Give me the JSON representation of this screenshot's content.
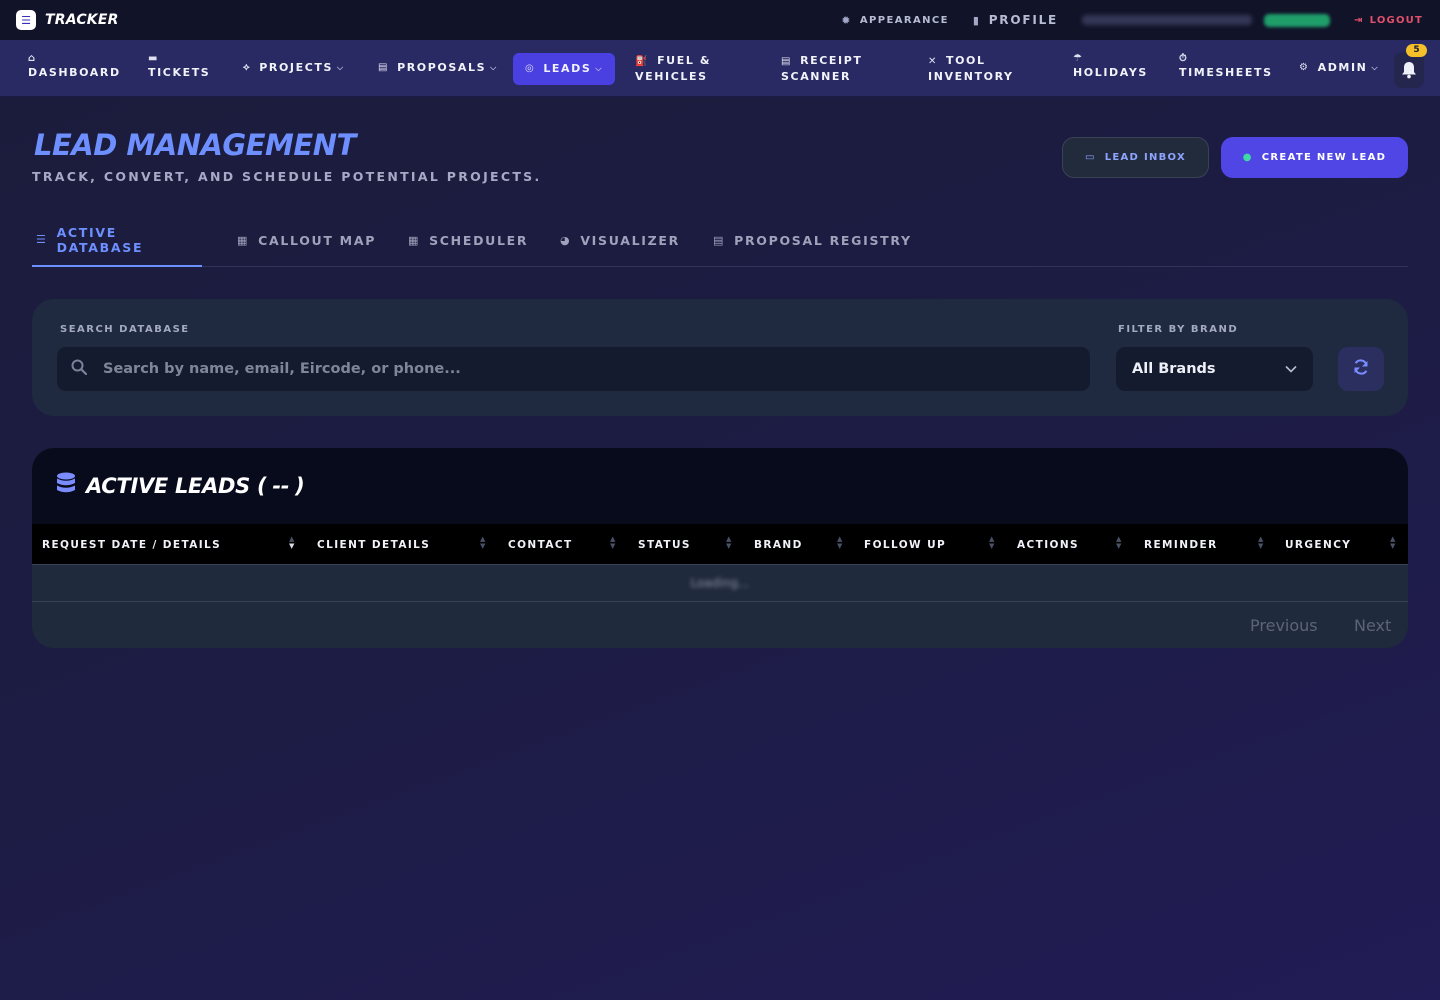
{
  "app": {
    "logo_glyph": "☰",
    "name": "TRACKER"
  },
  "topbar": {
    "appearance_label": "APPEARANCE",
    "profile_label": "PROFILE",
    "logout_label": "LOGOUT"
  },
  "nav": {
    "items": [
      {
        "label": "DASHBOARD",
        "icon": "home-icon",
        "glyph": "⌂"
      },
      {
        "label": "TICKETS",
        "icon": "ticket-icon",
        "glyph": "▬"
      },
      {
        "label": "PROJECTS",
        "icon": "sitemap-icon",
        "glyph": "⟡"
      },
      {
        "label": "PROPOSALS",
        "icon": "document-icon",
        "glyph": "▤"
      },
      {
        "label": "LEADS",
        "icon": "target-icon",
        "glyph": "◎"
      },
      {
        "label_line1": "FUEL &",
        "label_line2": "VEHICLES",
        "icon": "fuel-icon",
        "glyph": "⛽"
      },
      {
        "label_line1": "RECEIPT",
        "label_line2": "SCANNER",
        "icon": "receipt-icon",
        "glyph": "▤"
      },
      {
        "label_line1": "TOOL",
        "label_line2": "INVENTORY",
        "icon": "tools-icon",
        "glyph": "✕"
      },
      {
        "label": "HOLIDAYS",
        "icon": "umbrella-beach-icon",
        "glyph": "☂"
      },
      {
        "label": "TIMESHEETS",
        "icon": "stopwatch-icon",
        "glyph": "⏱"
      },
      {
        "label": "ADMIN",
        "icon": "user-gear-icon",
        "glyph": "⚙"
      }
    ],
    "notification_count": "5"
  },
  "header": {
    "title": "LEAD MANAGEMENT",
    "subtitle": "TRACK, CONVERT, AND SCHEDULE POTENTIAL PROJECTS.",
    "inbox_button": "LEAD INBOX",
    "create_button": "CREATE NEW LEAD"
  },
  "tabs": [
    {
      "label": "ACTIVE DATABASE",
      "icon": "list-icon",
      "glyph": "☰"
    },
    {
      "label": "CALLOUT MAP",
      "icon": "map-icon",
      "glyph": "▦"
    },
    {
      "label": "SCHEDULER",
      "icon": "calendar-icon",
      "glyph": "▦"
    },
    {
      "label": "VISUALIZER",
      "icon": "pie-chart-icon",
      "glyph": "◕"
    },
    {
      "label": "PROPOSAL REGISTRY",
      "icon": "file-icon",
      "glyph": "▤"
    }
  ],
  "filters": {
    "search_label": "SEARCH DATABASE",
    "search_placeholder": "Search by name, email, Eircode, or phone...",
    "search_value": "",
    "brand_label": "FILTER BY BRAND",
    "brand_selected": "All Brands"
  },
  "table": {
    "title_prefix": "ACTIVE LEADS (",
    "count": "--",
    "title_suffix": ")",
    "columns": [
      "REQUEST DATE / DETAILS",
      "CLIENT DETAILS",
      "CONTACT",
      "STATUS",
      "BRAND",
      "FOLLOW UP",
      "ACTIONS",
      "REMINDER",
      "URGENCY"
    ],
    "loading_text": "Loading...",
    "previous_label": "Previous",
    "next_label": "Next"
  },
  "colors": {
    "accent": "#4f46e5",
    "title_blue": "#6e8fff",
    "logout_red": "#e0506a",
    "badge_yellow": "#f5c02a"
  }
}
